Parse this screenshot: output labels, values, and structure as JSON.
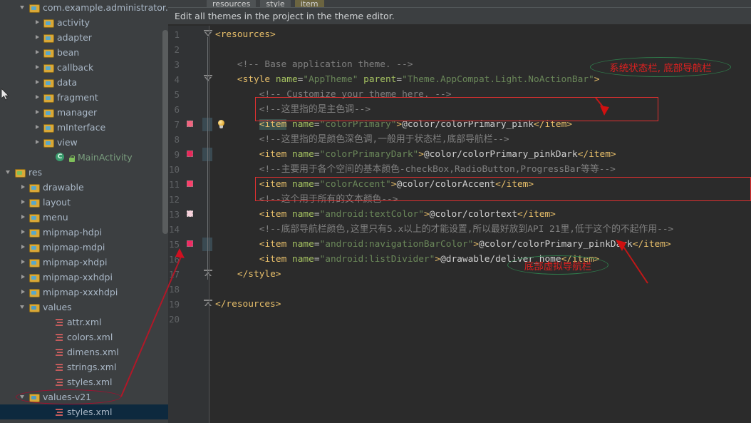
{
  "sidebar": {
    "items": [
      {
        "label": "com.example.administrator.m",
        "indent": 28,
        "twisty": "down",
        "icon": "folder-package",
        "kind": "folder",
        "selected": false
      },
      {
        "label": "activity",
        "indent": 48,
        "twisty": "right",
        "icon": "folder",
        "kind": "folder",
        "selected": false
      },
      {
        "label": "adapter",
        "indent": 48,
        "twisty": "right",
        "icon": "folder",
        "kind": "folder",
        "selected": false
      },
      {
        "label": "bean",
        "indent": 48,
        "twisty": "right",
        "icon": "folder",
        "kind": "folder",
        "selected": false
      },
      {
        "label": "callback",
        "indent": 48,
        "twisty": "right",
        "icon": "folder",
        "kind": "folder",
        "selected": false
      },
      {
        "label": "data",
        "indent": 48,
        "twisty": "right",
        "icon": "folder",
        "kind": "folder",
        "selected": false
      },
      {
        "label": "fragment",
        "indent": 48,
        "twisty": "right",
        "icon": "folder",
        "kind": "folder",
        "selected": false
      },
      {
        "label": "manager",
        "indent": 48,
        "twisty": "right",
        "icon": "folder",
        "kind": "folder",
        "selected": false
      },
      {
        "label": "mInterface",
        "indent": 48,
        "twisty": "right",
        "icon": "folder",
        "kind": "folder",
        "selected": false
      },
      {
        "label": "view",
        "indent": 48,
        "twisty": "right",
        "icon": "folder",
        "kind": "folder",
        "selected": false
      },
      {
        "label": "MainActivity",
        "indent": 65,
        "twisty": "none",
        "icon": "java-class",
        "kind": "class",
        "selected": false
      },
      {
        "label": "res",
        "indent": 8,
        "twisty": "down",
        "icon": "folder-res",
        "kind": "folder",
        "selected": false
      },
      {
        "label": "drawable",
        "indent": 28,
        "twisty": "right",
        "icon": "folder",
        "kind": "folder",
        "selected": false
      },
      {
        "label": "layout",
        "indent": 28,
        "twisty": "right",
        "icon": "folder",
        "kind": "folder",
        "selected": false
      },
      {
        "label": "menu",
        "indent": 28,
        "twisty": "right",
        "icon": "folder",
        "kind": "folder",
        "selected": false
      },
      {
        "label": "mipmap-hdpi",
        "indent": 28,
        "twisty": "right",
        "icon": "folder",
        "kind": "folder",
        "selected": false
      },
      {
        "label": "mipmap-mdpi",
        "indent": 28,
        "twisty": "right",
        "icon": "folder",
        "kind": "folder",
        "selected": false
      },
      {
        "label": "mipmap-xhdpi",
        "indent": 28,
        "twisty": "right",
        "icon": "folder",
        "kind": "folder",
        "selected": false
      },
      {
        "label": "mipmap-xxhdpi",
        "indent": 28,
        "twisty": "right",
        "icon": "folder",
        "kind": "folder",
        "selected": false
      },
      {
        "label": "mipmap-xxxhdpi",
        "indent": 28,
        "twisty": "right",
        "icon": "folder",
        "kind": "folder",
        "selected": false
      },
      {
        "label": "values",
        "indent": 28,
        "twisty": "down",
        "icon": "folder-values",
        "kind": "folder",
        "selected": false
      },
      {
        "label": "attr.xml",
        "indent": 64,
        "twisty": "none",
        "icon": "xml-file",
        "kind": "xml",
        "selected": false
      },
      {
        "label": "colors.xml",
        "indent": 64,
        "twisty": "none",
        "icon": "xml-file",
        "kind": "xml",
        "selected": false
      },
      {
        "label": "dimens.xml",
        "indent": 64,
        "twisty": "none",
        "icon": "xml-file",
        "kind": "xml",
        "selected": false
      },
      {
        "label": "strings.xml",
        "indent": 64,
        "twisty": "none",
        "icon": "xml-file",
        "kind": "xml",
        "selected": false
      },
      {
        "label": "styles.xml",
        "indent": 64,
        "twisty": "none",
        "icon": "xml-file",
        "kind": "xml",
        "selected": false
      },
      {
        "label": "values-v21",
        "indent": 28,
        "twisty": "down",
        "icon": "folder-values",
        "kind": "folder",
        "selected": false
      },
      {
        "label": "styles.xml",
        "indent": 64,
        "twisty": "none",
        "icon": "xml-file",
        "kind": "xml",
        "selected": true
      }
    ]
  },
  "breadcrumb": {
    "crumbs": [
      {
        "label": "resources",
        "active": false
      },
      {
        "label": "style",
        "active": false
      },
      {
        "label": "item",
        "active": true
      }
    ]
  },
  "notification": {
    "message": "Edit all themes in the project in the theme editor."
  },
  "editor": {
    "line_numbers": [
      "1",
      "2",
      "3",
      "4",
      "5",
      "6",
      "7",
      "8",
      "9",
      "10",
      "11",
      "12",
      "13",
      "14",
      "15",
      "16",
      "17",
      "18",
      "19",
      "20"
    ],
    "gutter_swatches": [
      {
        "line": 7,
        "color": "#f2647f"
      },
      {
        "line": 9,
        "color": "#e8285a"
      },
      {
        "line": 11,
        "color": "#fb3f6a"
      },
      {
        "line": 13,
        "color": "#f7d2dc"
      },
      {
        "line": 15,
        "color": "#ef2b63"
      }
    ],
    "lightbulb_line": 7,
    "lines": [
      {
        "n": 1,
        "indent": 0,
        "spans": [
          {
            "t": "<resources>",
            "c": "tag"
          }
        ]
      },
      {
        "n": 2,
        "indent": 0,
        "spans": []
      },
      {
        "n": 3,
        "indent": 4,
        "spans": [
          {
            "t": "<!-- Base application theme. -->",
            "c": "cmt"
          }
        ]
      },
      {
        "n": 4,
        "indent": 4,
        "spans": [
          {
            "t": "<style",
            "c": "tag"
          },
          {
            "t": " ",
            "c": "val"
          },
          {
            "t": "name",
            "c": "attr"
          },
          {
            "t": "=",
            "c": "val"
          },
          {
            "t": "\"AppTheme\"",
            "c": "aval"
          },
          {
            "t": " ",
            "c": "val"
          },
          {
            "t": "parent",
            "c": "attr"
          },
          {
            "t": "=",
            "c": "val"
          },
          {
            "t": "\"Theme.AppCompat.Light.NoActionBar\"",
            "c": "aval"
          },
          {
            "t": ">",
            "c": "tag"
          }
        ]
      },
      {
        "n": 5,
        "indent": 8,
        "spans": [
          {
            "t": "<!-- Customize your theme here. -->",
            "c": "cmt"
          }
        ]
      },
      {
        "n": 6,
        "indent": 8,
        "spans": [
          {
            "t": "<!--这里指的是主色调-->",
            "c": "cmt"
          }
        ]
      },
      {
        "n": 7,
        "indent": 8,
        "spans": [
          {
            "t": "<item",
            "c": "tag hlmatch"
          },
          {
            "t": " ",
            "c": "val"
          },
          {
            "t": "name",
            "c": "attr"
          },
          {
            "t": "=",
            "c": "val"
          },
          {
            "t": "\"colorPrimary\"",
            "c": "aval"
          },
          {
            "t": ">",
            "c": "tag"
          },
          {
            "t": "@color/colorPrimary_pink",
            "c": "val"
          },
          {
            "t": "</item>",
            "c": "tag"
          }
        ]
      },
      {
        "n": 8,
        "indent": 8,
        "spans": [
          {
            "t": "<!--这里指的是颜色深色调,一般用于状态栏,底部导航栏-->",
            "c": "cmt"
          }
        ]
      },
      {
        "n": 9,
        "indent": 8,
        "spans": [
          {
            "t": "<item",
            "c": "tag"
          },
          {
            "t": " ",
            "c": "val"
          },
          {
            "t": "name",
            "c": "attr"
          },
          {
            "t": "=",
            "c": "val"
          },
          {
            "t": "\"colorPrimaryDark\"",
            "c": "aval"
          },
          {
            "t": ">",
            "c": "tag"
          },
          {
            "t": "@color/colorPrimary_pinkDark",
            "c": "val"
          },
          {
            "t": "</item>",
            "c": "tag"
          }
        ]
      },
      {
        "n": 10,
        "indent": 8,
        "spans": [
          {
            "t": "<!--主要用于各个空间的基本颜色-checkBox,RadioButton,ProgressBar等等-->",
            "c": "cmt"
          }
        ]
      },
      {
        "n": 11,
        "indent": 8,
        "spans": [
          {
            "t": "<item",
            "c": "tag"
          },
          {
            "t": " ",
            "c": "val"
          },
          {
            "t": "name",
            "c": "attr"
          },
          {
            "t": "=",
            "c": "val"
          },
          {
            "t": "\"colorAccent\"",
            "c": "aval"
          },
          {
            "t": ">",
            "c": "tag"
          },
          {
            "t": "@color/colorAccent",
            "c": "val"
          },
          {
            "t": "</item>",
            "c": "tag"
          }
        ]
      },
      {
        "n": 12,
        "indent": 8,
        "spans": [
          {
            "t": "<!--这个用于所有的文本颜色-->",
            "c": "cmt"
          }
        ]
      },
      {
        "n": 13,
        "indent": 8,
        "spans": [
          {
            "t": "<item",
            "c": "tag"
          },
          {
            "t": " ",
            "c": "val"
          },
          {
            "t": "name",
            "c": "attr"
          },
          {
            "t": "=",
            "c": "val"
          },
          {
            "t": "\"android:textColor\"",
            "c": "aval"
          },
          {
            "t": ">",
            "c": "tag"
          },
          {
            "t": "@color/colortext",
            "c": "val"
          },
          {
            "t": "</item>",
            "c": "tag"
          }
        ]
      },
      {
        "n": 14,
        "indent": 8,
        "spans": [
          {
            "t": "<!--底部导航栏颜色,这里只有5.x以上的才能设置,所以最好放到API 21里,低于这个的不起作用-->",
            "c": "cmt"
          }
        ]
      },
      {
        "n": 15,
        "indent": 8,
        "spans": [
          {
            "t": "<item",
            "c": "tag"
          },
          {
            "t": " ",
            "c": "val"
          },
          {
            "t": "name",
            "c": "attr"
          },
          {
            "t": "=",
            "c": "val"
          },
          {
            "t": "\"android:navigationBarColor\"",
            "c": "aval"
          },
          {
            "t": ">",
            "c": "tag"
          },
          {
            "t": "@color/colorPrimary_pinkDark",
            "c": "val"
          },
          {
            "t": "</item>",
            "c": "tag"
          }
        ]
      },
      {
        "n": 16,
        "indent": 8,
        "spans": [
          {
            "t": "<item",
            "c": "tag"
          },
          {
            "t": " ",
            "c": "val"
          },
          {
            "t": "name",
            "c": "attr"
          },
          {
            "t": "=",
            "c": "val"
          },
          {
            "t": "\"android:listDivider\"",
            "c": "aval"
          },
          {
            "t": ">",
            "c": "tag"
          },
          {
            "t": "@drawable/deliver_home",
            "c": "val"
          },
          {
            "t": "</item>",
            "c": "tag"
          }
        ]
      },
      {
        "n": 17,
        "indent": 4,
        "spans": [
          {
            "t": "</style>",
            "c": "tag"
          }
        ]
      },
      {
        "n": 18,
        "indent": 0,
        "spans": []
      },
      {
        "n": 19,
        "indent": 0,
        "spans": [
          {
            "t": "</resources>",
            "c": "tag"
          }
        ]
      },
      {
        "n": 20,
        "indent": 0,
        "spans": []
      }
    ]
  },
  "annotations": {
    "callouts": [
      {
        "id": "status-bar-callout",
        "text": "系统状态栏, 底部导航栏"
      },
      {
        "id": "virtual-nav-callout",
        "text": "底部虚拟导航栏"
      }
    ],
    "colors": {
      "red": "#e02020",
      "green": "#2f7a4a",
      "crimson": "#a01030"
    }
  }
}
